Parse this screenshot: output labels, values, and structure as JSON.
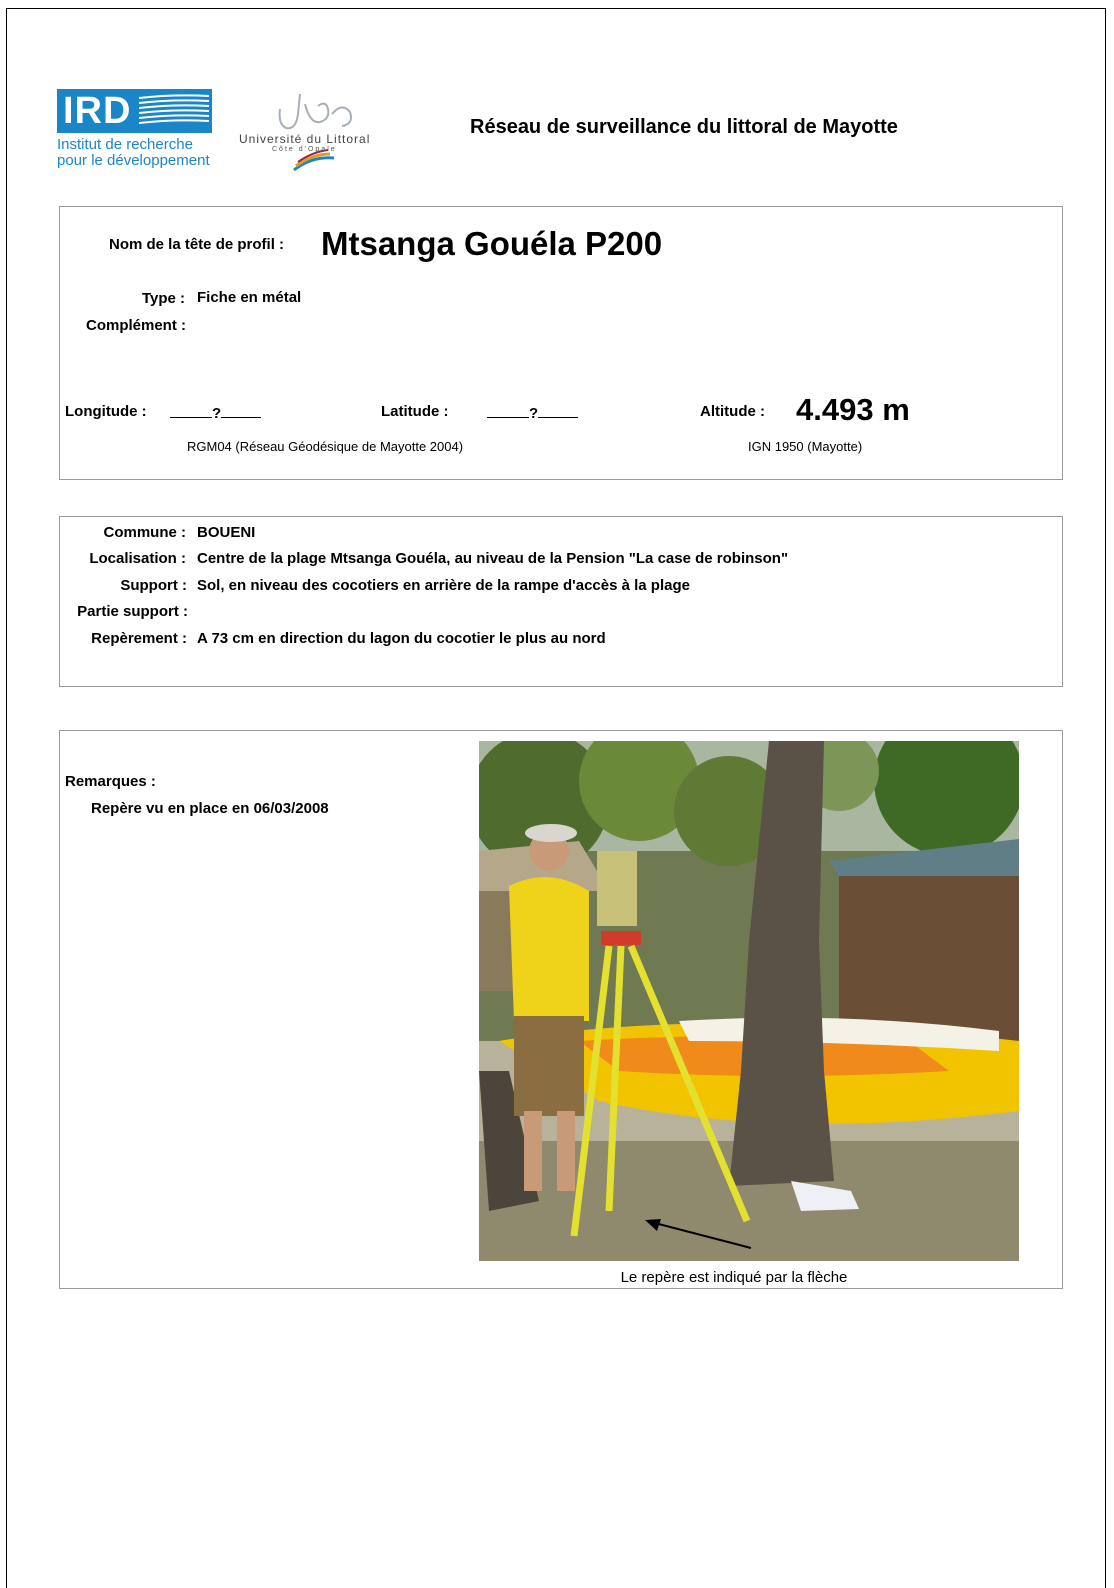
{
  "header": {
    "ird_letters": "IRD",
    "ird_line1": "Institut de recherche",
    "ird_line2": "pour le développement",
    "ulco_name": "Université du Littoral",
    "ulco_sub": "Côte d'Opale",
    "title": "Réseau de surveillance du littoral de Mayotte"
  },
  "profile": {
    "name_label": "Nom de la tête de profil :",
    "name_value": "Mtsanga Gouéla P200",
    "type_label": "Type :",
    "type_value": "Fiche en métal",
    "complement_label": "Complément :",
    "longitude_label": "Longitude :",
    "longitude_value": "?",
    "latitude_label": "Latitude :",
    "latitude_value": "?",
    "altitude_label": "Altitude :",
    "altitude_value": "4.493 m",
    "coord_system": "RGM04 (Réseau Géodésique de Mayotte 2004)",
    "altitude_system": "IGN 1950 (Mayotte)"
  },
  "location": {
    "commune_label": "Commune :",
    "commune_value": "BOUENI",
    "localisation_label": "Localisation :",
    "localisation_value": "Centre de la plage Mtsanga Gouéla, au niveau de la Pension \"La case de robinson\"",
    "support_label": "Support :",
    "support_value": "Sol, en niveau des cocotiers en arrière de la rampe d'accès à la plage",
    "partie_label": "Partie support :",
    "reperement_label": "Repèrement :",
    "reperement_value": "A 73 cm  en direction du lagon du cocotier le plus au nord"
  },
  "remarks": {
    "label": "Remarques :",
    "text": "Repère vu en place en 06/03/2008",
    "photo_caption": "Le repère est indiqué par la flèche"
  },
  "colors": {
    "ird_blue": "#1a86c8",
    "box_border": "#9a9a9a"
  }
}
